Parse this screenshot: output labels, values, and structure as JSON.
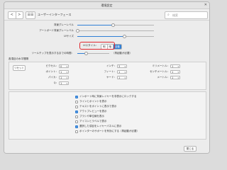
{
  "window": {
    "title": "環境設定",
    "close_label": "✕"
  },
  "toolbar": {
    "back_label": "<",
    "forward_label": ">",
    "grid_label": "☰☰",
    "title": "ユーザーインターフェース",
    "search_placeholder": "検索"
  },
  "appearance": {
    "background_brightness": {
      "label": "背景グレーレベル",
      "value": 0.47
    },
    "artboard_brightness": {
      "label": "アートボード背景グレーレベル",
      "value": 0.0
    },
    "ui_scale": {
      "label": "UIサイズ",
      "value": 0.62
    },
    "ui_style": {
      "label": "UIスタイル：",
      "options": [
        "明",
        "暗",
        "自動"
      ],
      "selected": "自動"
    },
    "tool_size": {
      "label": "ツールチップを表示するまでの時間：",
      "value": 0.27,
      "suffix": "（再起動が必要）"
    }
  },
  "shortcut_section": {
    "title": "各項目の水平間隔",
    "reset_label": "リセット",
    "rows": [
      [
        {
          "label": "ピクセル：",
          "value": "0"
        },
        {
          "label": "インチ：",
          "value": "3"
        },
        {
          "label": "ミリメートル：",
          "value": "1"
        }
      ],
      [
        {
          "label": "ポイント：",
          "value": "1"
        },
        {
          "label": "フィート：",
          "value": "1"
        },
        {
          "label": "センチメートル：",
          "value": "1"
        }
      ],
      [
        {
          "label": "パイカ：",
          "value": "1"
        },
        {
          "label": "ヤード：",
          "value": "1"
        },
        {
          "label": "メートル：",
          "value": "1"
        }
      ],
      [
        {
          "label": "Q：",
          "value": "1"
        },
        {
          "label": "",
          "value": ""
        },
        {
          "label": "",
          "value": ""
        }
      ]
    ],
    "dropdown_arrow": "▾"
  },
  "options": [
    {
      "label": "インポート時に背景レイヤーを非表示にロックする",
      "checked": true
    },
    {
      "label": "ラインとポイントを表示",
      "checked": false
    },
    {
      "label": "テキストをポイントに表示で表示",
      "checked": false
    },
    {
      "label": "アウトプレビューを表示",
      "checked": true
    },
    {
      "label": "ブラシや単位線を表示",
      "checked": false
    },
    {
      "label": "アイコンとラベルで表示",
      "checked": false
    },
    {
      "label": "選択した項目をレイヤーパネルに表示",
      "checked": true
    },
    {
      "label": "ポインターのサポートを有効にする（再起動が必要）",
      "checked": false
    }
  ],
  "footer": {
    "close_label": "閉じる"
  },
  "colors": {
    "accent": "#2f7fd6",
    "highlight": "#e0282e"
  }
}
